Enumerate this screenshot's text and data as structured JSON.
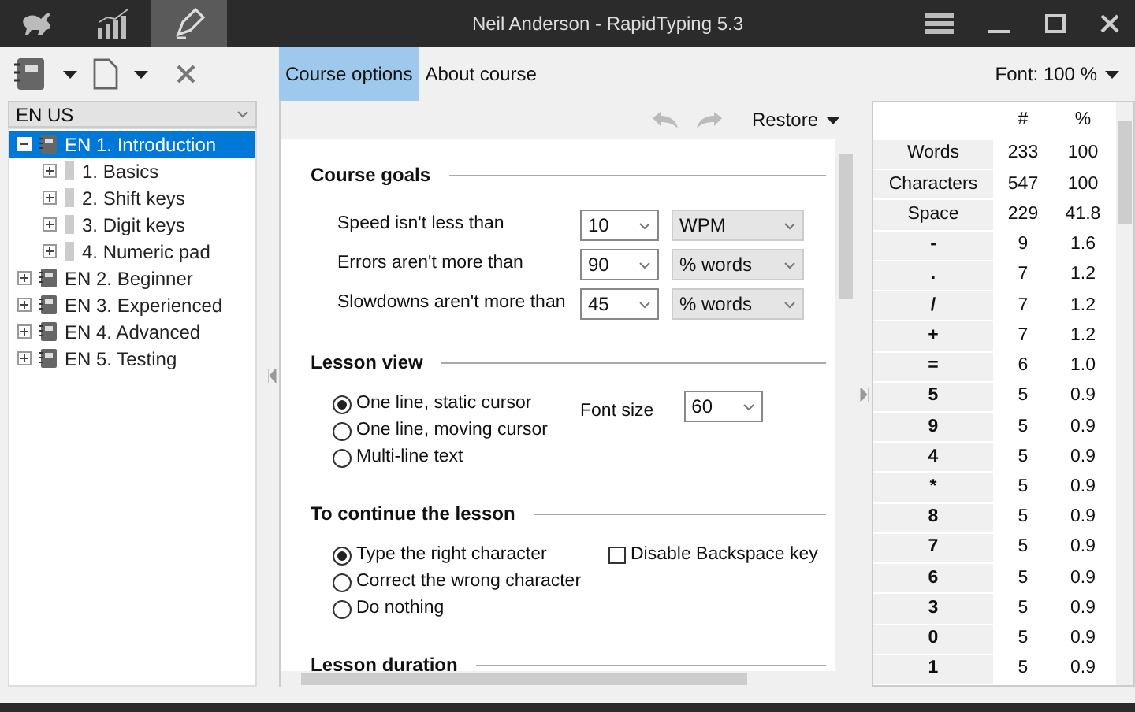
{
  "window": {
    "title": "Neil Anderson - RapidTyping 5.3"
  },
  "nav": [
    {
      "selected": false
    },
    {
      "selected": false
    },
    {
      "selected": true
    }
  ],
  "course_selector": {
    "value": "EN US"
  },
  "tree": [
    {
      "label": "EN 1. Introduction",
      "expanded": true,
      "selected": true,
      "children": [
        {
          "label": "1. Basics",
          "expanded": false,
          "selected": false
        },
        {
          "label": "2. Shift keys",
          "expanded": false,
          "selected": false
        },
        {
          "label": "3. Digit keys",
          "expanded": false,
          "selected": false
        },
        {
          "label": "4. Numeric pad",
          "expanded": false,
          "selected": false
        }
      ]
    },
    {
      "label": "EN 2. Beginner",
      "expanded": false,
      "selected": false
    },
    {
      "label": "EN 3. Experienced",
      "expanded": false,
      "selected": false
    },
    {
      "label": "EN 4. Advanced",
      "expanded": false,
      "selected": false
    },
    {
      "label": "EN 5. Testing",
      "expanded": false,
      "selected": false
    }
  ],
  "tabs": [
    {
      "label": "Course options",
      "selected": true
    },
    {
      "label": "About course",
      "selected": false
    }
  ],
  "font_menu": "Font: 100 %",
  "restore_button": "Restore",
  "course_goals": {
    "title": "Course goals",
    "rows": [
      {
        "label": "Speed isn't less than",
        "value": "10",
        "unit": "WPM"
      },
      {
        "label": "Errors aren't more than",
        "value": "90",
        "unit": "% words"
      },
      {
        "label": "Slowdowns aren't more than",
        "value": "45",
        "unit": "% words"
      }
    ]
  },
  "lesson_view": {
    "title": "Lesson view",
    "options": [
      {
        "label": "One line, static cursor",
        "selected": true
      },
      {
        "label": "One line, moving cursor",
        "selected": false
      },
      {
        "label": "Multi-line text",
        "selected": false
      }
    ],
    "font_size_label": "Font size",
    "font_size": "60"
  },
  "continue_lesson": {
    "title": "To continue the lesson",
    "options": [
      {
        "label": "Type the right character",
        "selected": true
      },
      {
        "label": "Correct the wrong character",
        "selected": false
      },
      {
        "label": "Do nothing",
        "selected": false
      }
    ],
    "checkbox": {
      "label": "Disable Backspace key",
      "checked": false
    }
  },
  "lesson_duration": {
    "title": "Lesson duration"
  },
  "stats": {
    "columns": [
      "#",
      "%"
    ],
    "rows": [
      {
        "kind": "summary",
        "label": "Words",
        "count": "233",
        "percent": "100"
      },
      {
        "kind": "summary",
        "label": "Characters",
        "count": "547",
        "percent": "100"
      },
      {
        "kind": "summary",
        "label": "Space",
        "count": "229",
        "percent": "41.8"
      },
      {
        "kind": "char",
        "label": "-",
        "count": "9",
        "percent": "1.6"
      },
      {
        "kind": "char",
        "label": ".",
        "count": "7",
        "percent": "1.2"
      },
      {
        "kind": "char",
        "label": "/",
        "count": "7",
        "percent": "1.2"
      },
      {
        "kind": "char",
        "label": "+",
        "count": "7",
        "percent": "1.2"
      },
      {
        "kind": "char",
        "label": "=",
        "count": "6",
        "percent": "1.0"
      },
      {
        "kind": "char",
        "label": "5",
        "count": "5",
        "percent": "0.9"
      },
      {
        "kind": "char",
        "label": "9",
        "count": "5",
        "percent": "0.9"
      },
      {
        "kind": "char",
        "label": "4",
        "count": "5",
        "percent": "0.9"
      },
      {
        "kind": "char",
        "label": "*",
        "count": "5",
        "percent": "0.9"
      },
      {
        "kind": "char",
        "label": "8",
        "count": "5",
        "percent": "0.9"
      },
      {
        "kind": "char",
        "label": "7",
        "count": "5",
        "percent": "0.9"
      },
      {
        "kind": "char",
        "label": "6",
        "count": "5",
        "percent": "0.9"
      },
      {
        "kind": "char",
        "label": "3",
        "count": "5",
        "percent": "0.9"
      },
      {
        "kind": "char",
        "label": "0",
        "count": "5",
        "percent": "0.9"
      },
      {
        "kind": "char",
        "label": "1",
        "count": "5",
        "percent": "0.9"
      }
    ]
  }
}
